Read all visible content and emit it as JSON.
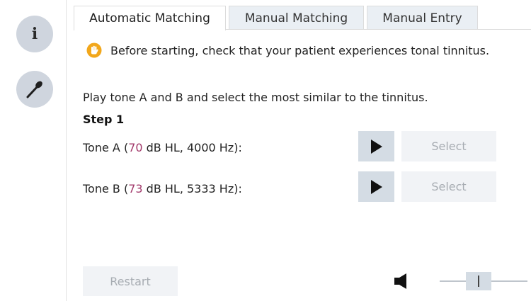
{
  "sidebar": {
    "info_glyph": "i",
    "items": [
      {
        "icon": "info-icon"
      },
      {
        "icon": "microphone-icon"
      }
    ]
  },
  "tabs": [
    {
      "label": "Automatic Matching",
      "active": true
    },
    {
      "label": "Manual Matching",
      "active": false
    },
    {
      "label": "Manual Entry",
      "active": false
    }
  ],
  "notice": {
    "icon": "hand-icon",
    "text": "Before starting, check that your patient experiences tonal tinnitus."
  },
  "instruction": "Play tone A and B and select the most similar to the tinnitus.",
  "step_title": "Step 1",
  "tones": [
    {
      "prefix": "Tone A (",
      "level": "70",
      "suffix": " dB HL, 4000 Hz):",
      "select_label": "Select"
    },
    {
      "prefix": "Tone B (",
      "level": "73",
      "suffix": " dB HL, 5333 Hz):",
      "select_label": "Select"
    }
  ],
  "restart_label": "Restart",
  "volume": {
    "icon": "speaker-icon",
    "level": 0.4
  },
  "colors": {
    "level_value": "#a23a6b",
    "hand_icon": "#f2a71b",
    "button_bg": "#d4dce4",
    "disabled_text": "#a7acb2"
  }
}
